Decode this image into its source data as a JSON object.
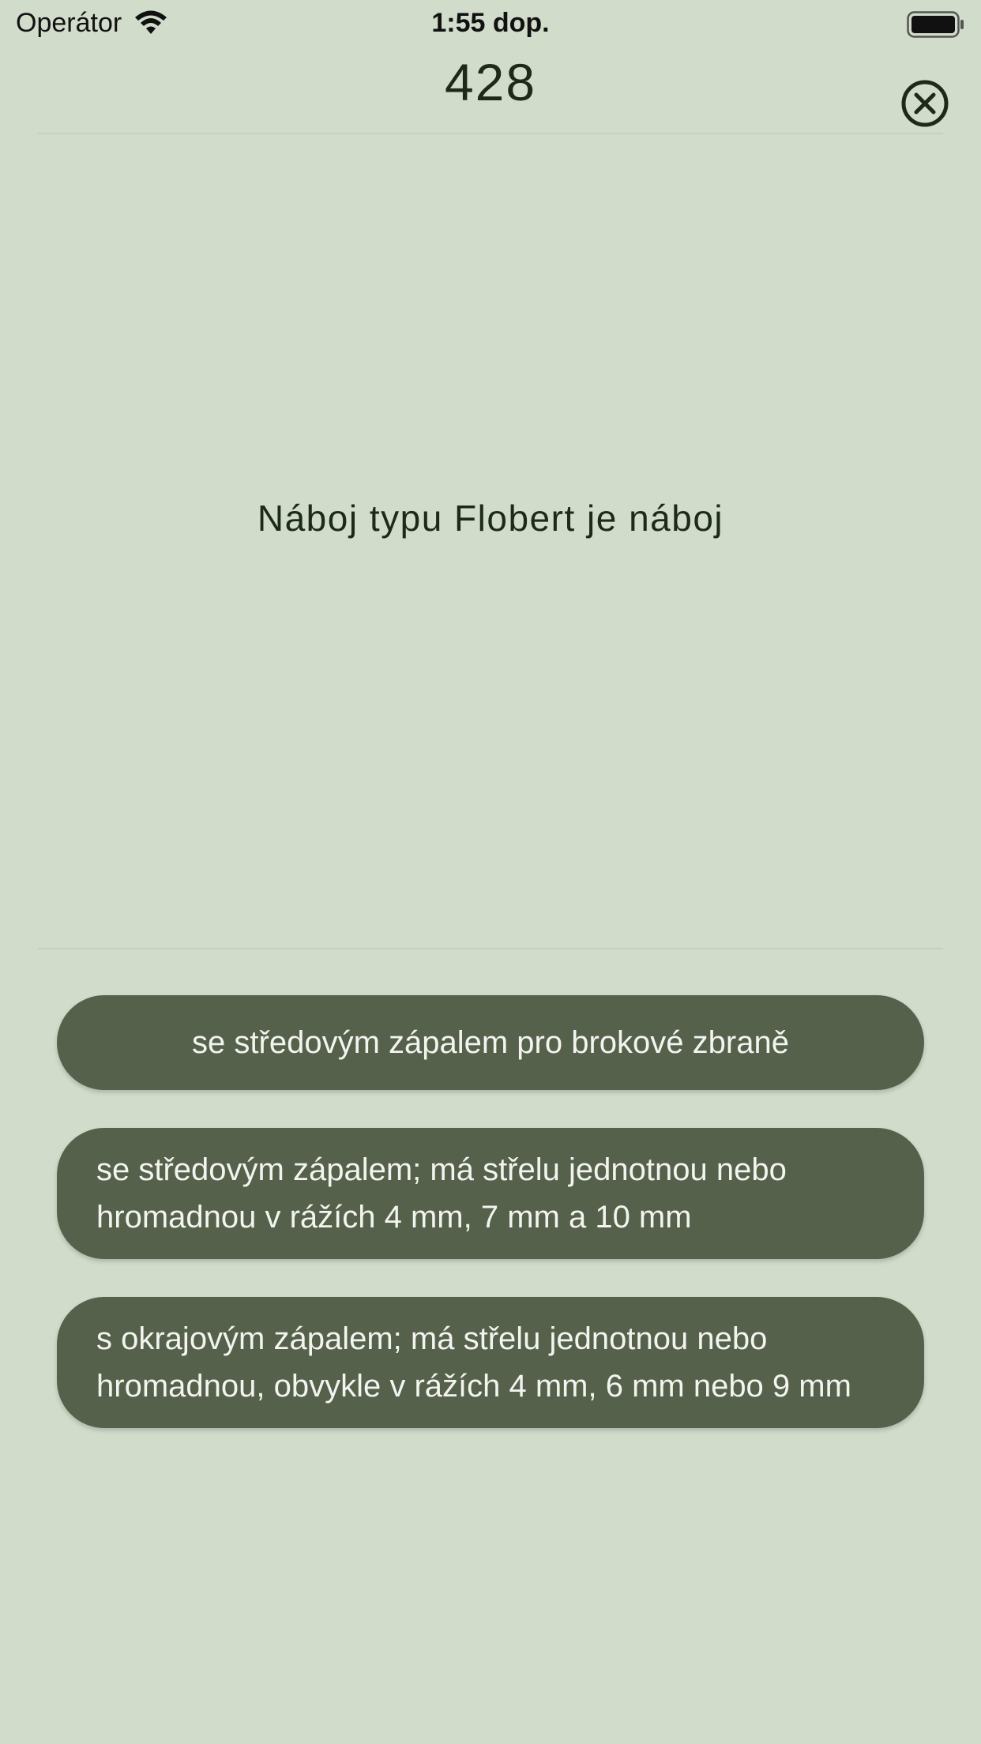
{
  "status_bar": {
    "carrier": "Operátor",
    "time": "1:55 dop.",
    "wifi_icon": "wifi-icon",
    "battery_icon": "battery-full-icon"
  },
  "header": {
    "counter": "428",
    "close_icon": "close-circle-icon"
  },
  "question": {
    "text": "Náboj typu Flobert je náboj"
  },
  "answers": [
    {
      "label": "se středovým zápalem pro brokové zbraně"
    },
    {
      "label": "se středovým zápalem; má střelu jednotnou nebo hromadnou v rážích 4 mm, 7 mm a 10 mm"
    },
    {
      "label": "s okrajovým zápalem; má střelu jednotnou nebo hromadnou, obvykle v rážích 4 mm, 6 mm nebo 9 mm"
    }
  ],
  "colors": {
    "background": "#d1dccb",
    "answer_button": "#55614b",
    "answer_text": "#f3f4ef",
    "primary_text": "#1d2a18"
  }
}
